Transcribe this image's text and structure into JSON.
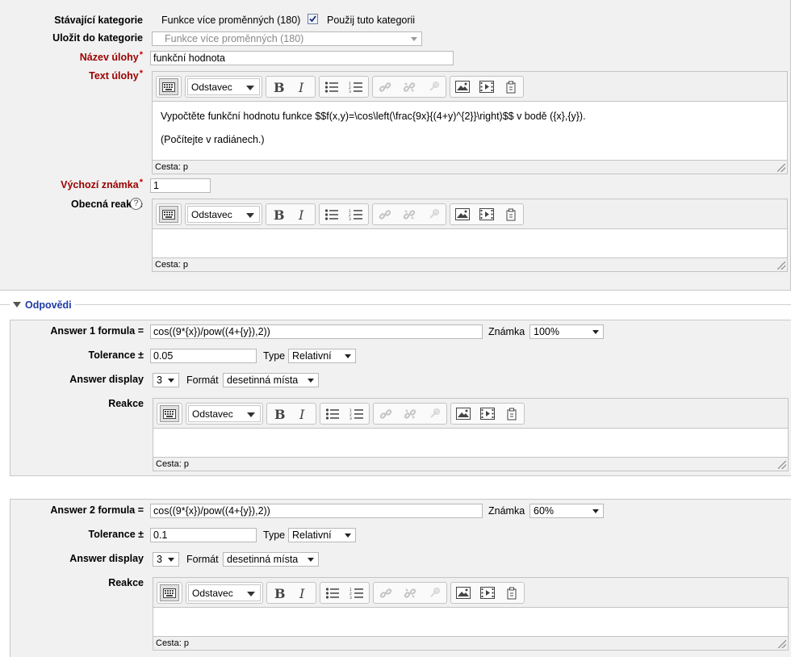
{
  "general": {
    "current_category_label": "Stávající kategorie",
    "current_category_value": "Funkce více proměnných (180)",
    "use_category_label": "Použij tuto kategorii",
    "save_category_label": "Uložit do kategorie",
    "save_category_value": "Funkce více proměnných (180)",
    "name_label": "Název úlohy",
    "name_value": "funkční hodnota",
    "text_label": "Text úlohy",
    "text_line1": "Vypočtěte funkční hodnotu funkce $$f(x,y)=\\cos\\left(\\frac{9x}{(4+y)^{2}}\\right)$$ v bodě ({x},{y}).",
    "text_line2": "(Počítejte v radiánech.)",
    "default_mark_label": "Výchozí známka",
    "default_mark_value": "1",
    "feedback_label": "Obecná reakce",
    "required_mark": "*"
  },
  "editor": {
    "format_label": "Odstavec",
    "path_label": "Cesta: p"
  },
  "answers_section": {
    "title": "Odpovědi"
  },
  "answers": [
    {
      "formula_label": "Answer 1 formula =",
      "formula_value": "cos((9*{x})/pow((4+{y}),2))",
      "grade_label": "Známka",
      "grade_value": "100%",
      "tolerance_label": "Tolerance ±",
      "tolerance_value": "0.05",
      "type_label": "Type",
      "type_value": "Relativní",
      "display_label": "Answer display",
      "display_value": "3",
      "format_label": "Formát",
      "format_value": "desetinná místa",
      "feedback_label": "Reakce"
    },
    {
      "formula_label": "Answer 2 formula =",
      "formula_value": "cos((9*{x})/pow((4+{y}),2))",
      "grade_label": "Známka",
      "grade_value": "60%",
      "tolerance_label": "Tolerance ±",
      "tolerance_value": "0.1",
      "type_label": "Type",
      "type_value": "Relativní",
      "display_label": "Answer display",
      "display_value": "3",
      "format_label": "Formát",
      "format_value": "desetinná místa",
      "feedback_label": "Reakce"
    }
  ],
  "colors": {
    "required": "#9b0000",
    "section_title": "#1f3aa8",
    "panel_bg": "#f1f1f1"
  }
}
